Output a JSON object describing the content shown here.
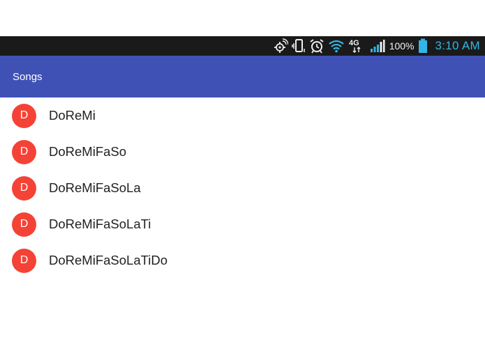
{
  "status_bar": {
    "icons": [
      "gps-icon",
      "vibrate-icon",
      "alarm-icon",
      "wifi-icon",
      "network-4g-icon",
      "signal-icon",
      "battery-icon"
    ],
    "network_label": "4G",
    "battery_percent": "100%",
    "time": "3:10 AM",
    "clock_color": "#33b5e5"
  },
  "app_bar": {
    "title": "Songs",
    "color": "#3f51b5"
  },
  "songs": [
    {
      "initial": "D",
      "title": "DoReMi"
    },
    {
      "initial": "D",
      "title": "DoReMiFaSo"
    },
    {
      "initial": "D",
      "title": "DoReMiFaSoLa"
    },
    {
      "initial": "D",
      "title": "DoReMiFaSoLaTi"
    },
    {
      "initial": "D",
      "title": "DoReMiFaSoLaTiDo"
    }
  ],
  "avatar_color": "#f44336"
}
